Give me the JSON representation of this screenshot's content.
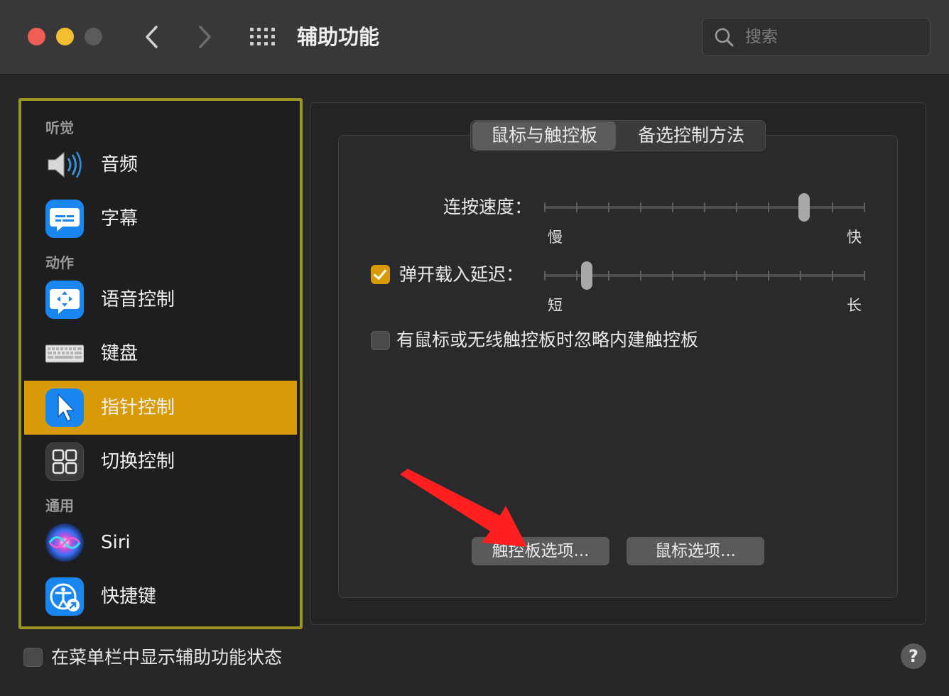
{
  "window": {
    "title": "辅助功能",
    "back_glyph": "‹",
    "forward_glyph": "›",
    "search_placeholder": "搜索"
  },
  "sidebar": {
    "sections": [
      {
        "label": "听觉"
      },
      {
        "label": "动作"
      },
      {
        "label": "通用"
      }
    ],
    "items": [
      {
        "label": "音频",
        "icon": "speaker-icon"
      },
      {
        "label": "字幕",
        "icon": "captions-icon"
      },
      {
        "label": "语音控制",
        "icon": "voice-control-icon"
      },
      {
        "label": "键盘",
        "icon": "keyboard-icon"
      },
      {
        "label": "指针控制",
        "icon": "pointer-icon",
        "selected": true
      },
      {
        "label": "切换控制",
        "icon": "switch-control-icon"
      },
      {
        "label": "Siri",
        "icon": "siri-icon"
      },
      {
        "label": "快捷键",
        "icon": "accessibility-shortcut-icon"
      }
    ]
  },
  "tabs": [
    {
      "label": "鼠标与触控板",
      "active": true
    },
    {
      "label": "备选控制方法",
      "active": false
    }
  ],
  "double_click_speed": {
    "label": "连按速度：",
    "min_label": "慢",
    "max_label": "快",
    "value_fraction": 0.82
  },
  "spring_loading": {
    "label": "弹开载入延迟：",
    "checked": true,
    "min_label": "短",
    "max_label": "长",
    "value_fraction": 0.12
  },
  "ignore_builtin": {
    "label": "有鼠标或无线触控板时忽略内建触控板",
    "checked": false
  },
  "buttons": {
    "trackpad_options": "触控板选项...",
    "mouse_options": "鼠标选项..."
  },
  "footer": {
    "show_status_label": "在菜单栏中显示辅助功能状态",
    "show_status_checked": false,
    "help_glyph": "?"
  },
  "colors": {
    "accent": "#d89a06",
    "sidebar_highlight_border": "#9b9524",
    "annotation_arrow": "#ff1f1f"
  }
}
